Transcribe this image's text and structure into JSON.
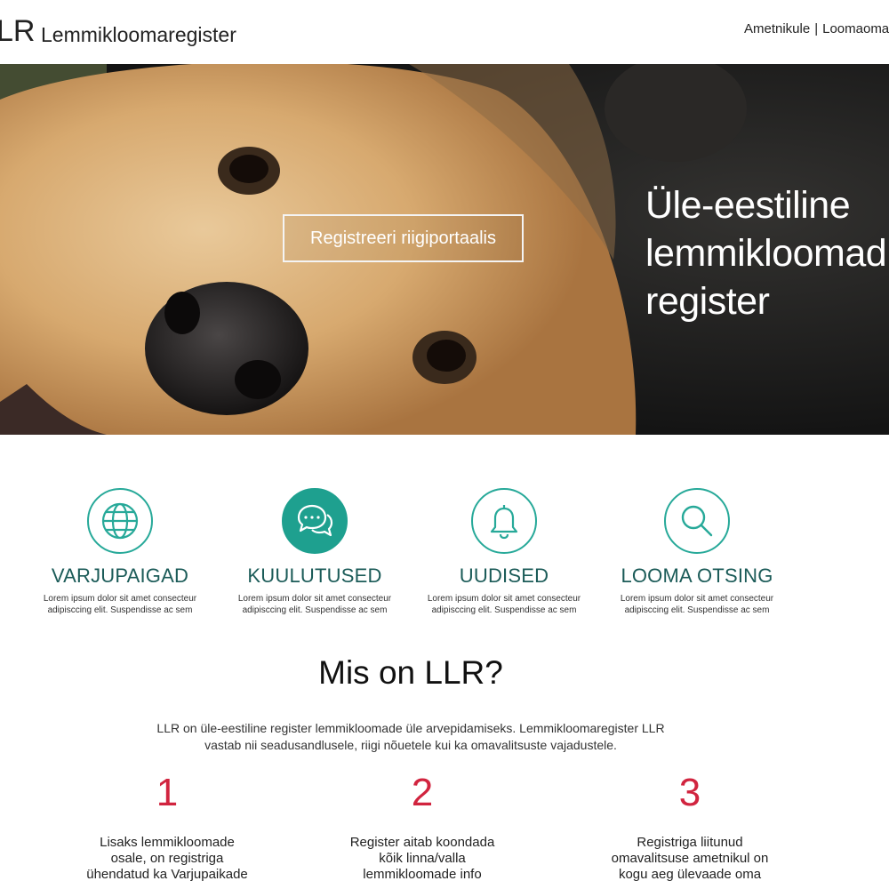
{
  "header": {
    "logo_mark": "LR",
    "site_name": "Lemmikloomaregister",
    "nav": [
      "Ametnikule",
      "Loomaoma"
    ]
  },
  "hero": {
    "title_lines": [
      "Üle-eestiline",
      "lemmikloomad",
      "register"
    ],
    "cta_label": "Registreeri riigiportaalis"
  },
  "features": [
    {
      "title": "VARJUPAIGAD",
      "desc_lines": [
        "Lorem ipsum dolor sit amet consecteur",
        "adipisccing elit. Suspendisse ac sem"
      ],
      "icon": "globe-icon"
    },
    {
      "title": "KUULUTUSED",
      "desc_lines": [
        "Lorem ipsum dolor sit amet consecteur",
        "adipisccing elit. Suspendisse ac sem"
      ],
      "icon": "chat-bubbles-icon"
    },
    {
      "title": "UUDISED",
      "desc_lines": [
        "Lorem ipsum dolor sit amet consecteur",
        "adipisccing elit. Suspendisse ac sem"
      ],
      "icon": "bell-icon"
    },
    {
      "title": "LOOMA OTSING",
      "desc_lines": [
        "Lorem ipsum dolor sit amet consecteur",
        "adipisccing elit. Suspendisse ac sem"
      ],
      "icon": "search-icon"
    }
  ],
  "about": {
    "title": "Mis on LLR?",
    "lead_lines": [
      "LLR on üle-eestiline register lemmikloomade üle arvepidamiseks. Lemmikloomaregister LLR",
      "vastab nii seadusandlusele, riigi nõuetele kui ka omavalitsuste vajadustele."
    ],
    "steps": [
      {
        "number": "1",
        "lines": [
          "Lisaks lemmikloomade",
          "osale, on registriga",
          "ühendatud ka Varjupaikade"
        ]
      },
      {
        "number": "2",
        "lines": [
          "Register aitab koondada",
          "kõik linna/valla",
          "lemmikloomade info"
        ]
      },
      {
        "number": "3",
        "lines": [
          "Registriga liitunud",
          "omavalitsuse ametnikul on",
          "kogu aeg ülevaade oma"
        ]
      }
    ]
  },
  "colors": {
    "accent": "#1ea08f",
    "feature_title": "#1b5b58",
    "step_number": "#d1243f"
  }
}
